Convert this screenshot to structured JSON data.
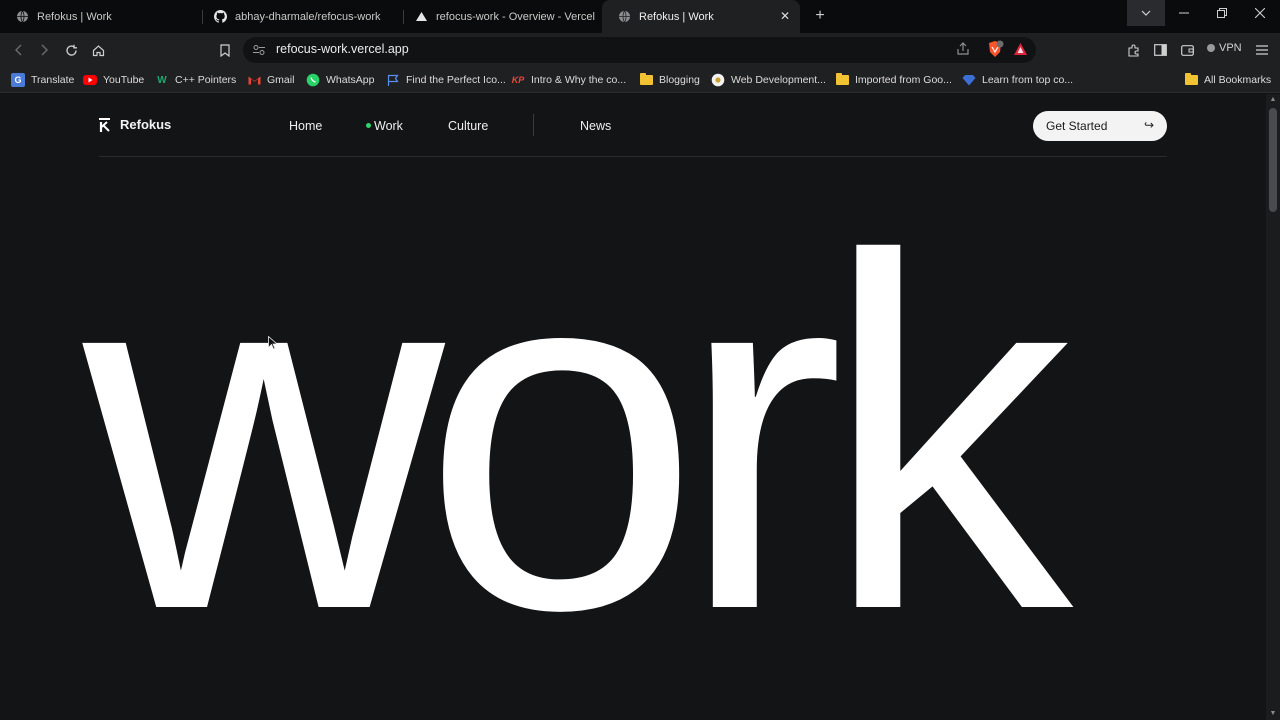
{
  "browser": {
    "tabs": [
      {
        "title": "Refokus | Work",
        "icon": "globe-icon",
        "active": false
      },
      {
        "title": "abhay-dharmale/refocus-work",
        "icon": "github-icon",
        "active": false
      },
      {
        "title": "refocus-work - Overview - Vercel",
        "icon": "vercel-icon",
        "active": false
      },
      {
        "title": "Refokus | Work",
        "icon": "globe-icon",
        "active": true
      }
    ],
    "new_tab_label": "+",
    "close_tab_label": "✕",
    "url": "refocus-work.vercel.app",
    "vpn_label": "VPN",
    "bookmarks": [
      {
        "label": "Translate",
        "icon": "translate-icon"
      },
      {
        "label": "YouTube",
        "icon": "youtube-icon"
      },
      {
        "label": "C++ Pointers",
        "icon": "pointer-icon"
      },
      {
        "label": "Gmail",
        "icon": "gmail-icon"
      },
      {
        "label": "WhatsApp",
        "icon": "whatsapp-icon"
      },
      {
        "label": "Find the Perfect Ico...",
        "icon": "flag-icon"
      },
      {
        "label": "Intro & Why the co...",
        "icon": "kp-icon"
      },
      {
        "label": "Blogging",
        "icon": "folder-icon"
      },
      {
        "label": "Web Development...",
        "icon": "chrome-icon"
      },
      {
        "label": "Imported from Goo...",
        "icon": "folder-icon"
      },
      {
        "label": "Learn from top co...",
        "icon": "diamond-icon"
      }
    ],
    "all_bookmarks_label": "All Bookmarks",
    "brave_badge": "1"
  },
  "site": {
    "brand": "Refokus",
    "nav": [
      {
        "label": "Home",
        "active": false
      },
      {
        "label": "Work",
        "active": true
      },
      {
        "label": "Culture",
        "active": false
      },
      {
        "label": "News",
        "active": false
      }
    ],
    "cta_label": "Get Started",
    "cta_arrow": "↪",
    "hero_text": "work"
  },
  "colors": {
    "page_bg": "#131416",
    "accent_dot": "#2fd46a",
    "cta_bg": "#f3f3f3"
  }
}
